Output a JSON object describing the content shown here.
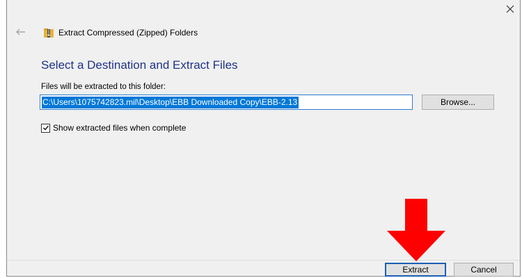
{
  "window": {
    "title": "Extract Compressed (Zipped) Folders"
  },
  "content": {
    "heading": "Select a Destination and Extract Files",
    "path_label": "Files will be extracted to this folder:",
    "path_value": "C:\\Users\\1075742823.mil\\Desktop\\EBB Downloaded Copy\\EBB-2.13",
    "browse_label": "Browse...",
    "checkbox_label": "Show extracted files when complete",
    "checkbox_checked": true
  },
  "footer": {
    "extract_label": "Extract",
    "cancel_label": "Cancel"
  },
  "icons": {
    "close": "close-icon",
    "back": "back-arrow-icon",
    "zip": "zip-folder-icon",
    "check": "checkmark-icon",
    "annotation": "red-down-arrow-icon"
  },
  "colors": {
    "heading": "#1e3287",
    "selection": "#0078d7",
    "annotation_arrow": "#ff0000",
    "default_button_border": "#1a5fb4"
  }
}
